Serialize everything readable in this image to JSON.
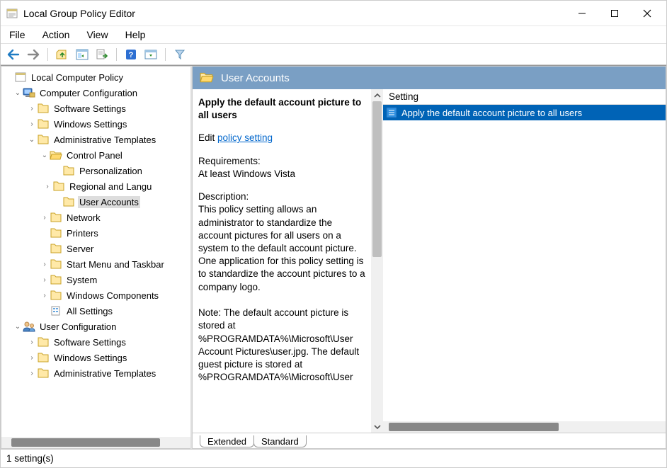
{
  "window": {
    "title": "Local Group Policy Editor"
  },
  "menu": {
    "file": "File",
    "action": "Action",
    "view": "View",
    "help": "Help"
  },
  "tree": {
    "root": "Local Computer Policy",
    "comp_config": "Computer Configuration",
    "comp_software": "Software Settings",
    "comp_windows": "Windows Settings",
    "comp_admin": "Administrative Templates",
    "control_panel": "Control Panel",
    "personalization": "Personalization",
    "regional": "Regional and Langu",
    "user_accounts": "User Accounts",
    "network": "Network",
    "printers": "Printers",
    "server": "Server",
    "start_menu": "Start Menu and Taskbar",
    "system": "System",
    "win_components": "Windows Components",
    "all_settings": "All Settings",
    "user_config": "User Configuration",
    "user_software": "Software Settings",
    "user_windows": "Windows Settings",
    "user_admin": "Administrative Templates"
  },
  "details": {
    "category_title": "User Accounts",
    "policy_title": "Apply the default account picture to all users",
    "edit_prefix": "Edit ",
    "edit_link": "policy setting",
    "requirements_label": "Requirements:",
    "requirements_text": "At least Windows Vista",
    "description_label": "Description:",
    "description_body": "This policy setting allows an administrator to standardize the account pictures for all users on a system to the default account picture. One application for this policy setting is to standardize the account pictures to a company logo.\n\nNote: The default account picture is stored at %PROGRAMDATA%\\Microsoft\\User Account Pictures\\user.jpg. The default guest picture is stored at %PROGRAMDATA%\\Microsoft\\User"
  },
  "list": {
    "header_setting": "Setting",
    "row0": "Apply the default account picture to all users"
  },
  "tabs": {
    "extended": "Extended",
    "standard": "Standard"
  },
  "status": {
    "text": "1 setting(s)"
  }
}
